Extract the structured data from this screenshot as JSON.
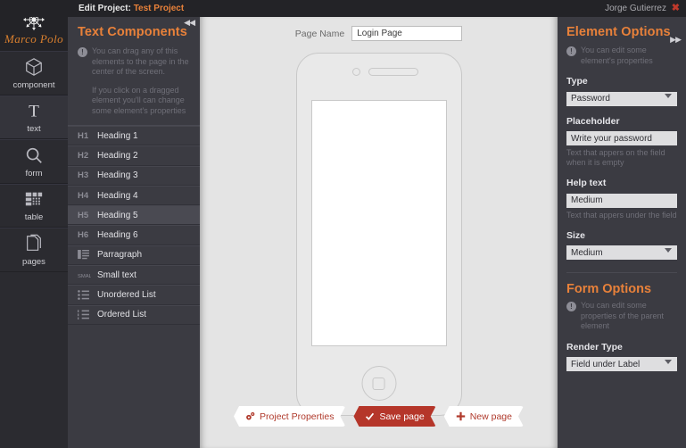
{
  "topbar": {
    "edit_label": "Edit Project:",
    "project_name": "Test Project",
    "user_name": "Jorge Gutierrez",
    "logout_icon": "close-x-icon"
  },
  "brand": {
    "name": "Marco Polo",
    "logo_icon": "ships-wheel-icon"
  },
  "rail": {
    "items": [
      {
        "label": "component",
        "icon": "cube-icon",
        "active": false
      },
      {
        "label": "text",
        "icon": "letter-t-icon",
        "active": true
      },
      {
        "label": "form",
        "icon": "magnifier-icon",
        "active": false
      },
      {
        "label": "table",
        "icon": "table-grid-icon",
        "active": false
      },
      {
        "label": "pages",
        "icon": "pages-copy-icon",
        "active": false
      }
    ]
  },
  "left_panel": {
    "title": "Text Components",
    "collapse_icon": "double-chevron-left-icon",
    "note1": "You can drag any of this elements to the page in the center of the screen.",
    "note2": "If you click on a dragged element you'll can change some element's properties",
    "components": [
      {
        "tag": "H1",
        "label": "Heading 1",
        "icon": "",
        "highlighted": false
      },
      {
        "tag": "H2",
        "label": "Heading 2",
        "icon": "",
        "highlighted": false
      },
      {
        "tag": "H3",
        "label": "Heading 3",
        "icon": "",
        "highlighted": false
      },
      {
        "tag": "H4",
        "label": "Heading 4",
        "icon": "",
        "highlighted": false
      },
      {
        "tag": "H5",
        "label": "Heading 5",
        "icon": "",
        "highlighted": true
      },
      {
        "tag": "H6",
        "label": "Heading 6",
        "icon": "",
        "highlighted": false
      },
      {
        "tag": "",
        "label": "Parragraph",
        "icon": "paragraph-lines-icon",
        "highlighted": false
      },
      {
        "tag": "",
        "label": "Small text",
        "icon": "small-text-icon",
        "highlighted": false
      },
      {
        "tag": "",
        "label": "Unordered List",
        "icon": "bullet-list-icon",
        "highlighted": false
      },
      {
        "tag": "",
        "label": "Ordered List",
        "icon": "numbered-list-icon",
        "highlighted": false
      }
    ]
  },
  "canvas": {
    "page_name_label": "Page Name",
    "page_name_value": "Login Page",
    "page_name_placeholder": "Page Name",
    "phone": {
      "camera_icon": "camera-dot-icon",
      "speaker_icon": "speaker-slot-icon",
      "home_icon": "home-button-icon"
    },
    "buttons": [
      {
        "label": "Project Properties",
        "icon": "gears-icon",
        "primary": false
      },
      {
        "label": "Save page",
        "icon": "check-icon",
        "primary": true
      },
      {
        "label": "New page",
        "icon": "plus-icon",
        "primary": false
      }
    ]
  },
  "right_panel": {
    "title": "Element Options",
    "collapse_icon": "double-chevron-right-icon",
    "note": "You can edit  some element's properties",
    "fields": [
      {
        "label": "Type",
        "value": "Password",
        "kind": "select",
        "hint": ""
      },
      {
        "label": "Placeholder",
        "value": "Write your password",
        "kind": "input",
        "hint": "Text that appers on the field when it is empty"
      },
      {
        "label": "Help text",
        "value": "Medium",
        "kind": "input",
        "hint": "Text that appers under the field"
      },
      {
        "label": "Size",
        "value": "Medium",
        "kind": "select",
        "hint": ""
      }
    ],
    "form_title": "Form Options",
    "form_note": "You can edit  some properties of the parent element",
    "form_fields": [
      {
        "label": "Render Type",
        "value": "Field under Label",
        "kind": "select",
        "hint": ""
      }
    ]
  },
  "colors": {
    "accent_orange": "#e8813a",
    "panel_bg": "#3b3b42",
    "rail_bg": "#2b2b30",
    "canvas_bg": "#e4e4e4",
    "primary_red": "#b5362a"
  }
}
